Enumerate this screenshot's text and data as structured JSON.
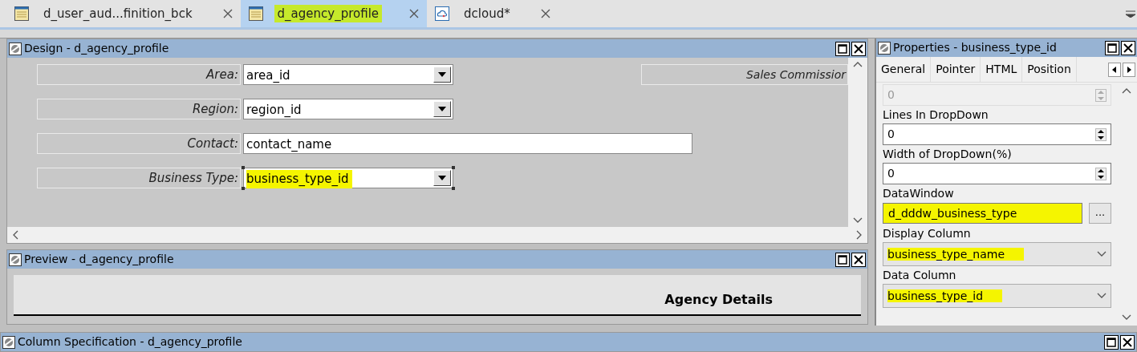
{
  "tabs": [
    {
      "label": "d_user_aud...finition_bck",
      "selected": false,
      "highlighted": false,
      "kind": "datawindow"
    },
    {
      "label": "d_agency_profile",
      "selected": true,
      "highlighted": true,
      "kind": "datawindow"
    },
    {
      "label": "dcloud*",
      "selected": false,
      "highlighted": false,
      "kind": "cloud"
    }
  ],
  "design": {
    "title": "Design - d_agency_profile",
    "side_label": "Sales Commissior",
    "fields": [
      {
        "label": "Area:",
        "value": "area_id",
        "kind": "dropdown",
        "selected": false,
        "highlighted": false
      },
      {
        "label": "Region:",
        "value": "region_id",
        "kind": "dropdown",
        "selected": false,
        "highlighted": false
      },
      {
        "label": "Contact:",
        "value": "contact_name",
        "kind": "text",
        "selected": false,
        "highlighted": false
      },
      {
        "label": "Business Type:",
        "value": "business_type_id",
        "kind": "dropdown",
        "selected": true,
        "highlighted": true
      }
    ]
  },
  "preview": {
    "title": "Preview - d_agency_profile",
    "heading": "Agency Details"
  },
  "properties": {
    "title": "Properties - business_type_id",
    "tabs": [
      "General",
      "Pointer",
      "HTML",
      "Position"
    ],
    "rows": [
      {
        "kind": "spin",
        "value": "0",
        "disabled": true,
        "highlighted": false
      },
      {
        "kind": "label",
        "text": "Lines In DropDown"
      },
      {
        "kind": "spin",
        "value": "0",
        "disabled": false,
        "highlighted": false
      },
      {
        "kind": "label",
        "text": "Width of DropDown(%)"
      },
      {
        "kind": "spin",
        "value": "0",
        "disabled": false,
        "highlighted": false
      },
      {
        "kind": "label",
        "text": "DataWindow"
      },
      {
        "kind": "browse",
        "value": "d_dddw_business_type",
        "button": "...",
        "highlighted": true
      },
      {
        "kind": "label",
        "text": "Display Column"
      },
      {
        "kind": "select",
        "value": "business_type_name",
        "highlighted": true
      },
      {
        "kind": "label",
        "text": "Data Column"
      },
      {
        "kind": "select",
        "value": "business_type_id",
        "highlighted": true
      }
    ]
  },
  "column_spec": {
    "title": "Column Specification - d_agency_profile"
  }
}
